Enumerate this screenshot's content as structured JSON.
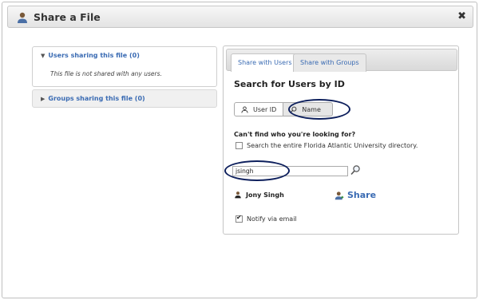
{
  "dialog": {
    "title": "Share a File",
    "title_icon": "user-icon",
    "close_label": "✖"
  },
  "left": {
    "users_header": "Users sharing this file (0)",
    "users_body": "This file is not shared with any users.",
    "groups_header": "Groups sharing this file (0)"
  },
  "right": {
    "tabs": [
      "Share with Users",
      "Share with Groups"
    ],
    "heading": "Search for Users by ID",
    "toggle_user_label": "User ID",
    "toggle_name_label": "Name",
    "cant_find": "Can't find who you're looking for?",
    "directory_label": "Search the entire Florida Atlantic University directory.",
    "directory_checked": false,
    "search_value": "jsingh",
    "result_user": "Jony Singh",
    "share_label": "Share",
    "notify_label": "Notify via email",
    "notify_checked": true
  },
  "colors": {
    "link_blue": "#3a6bb3",
    "highlight_oval": "#0d1f5c"
  }
}
